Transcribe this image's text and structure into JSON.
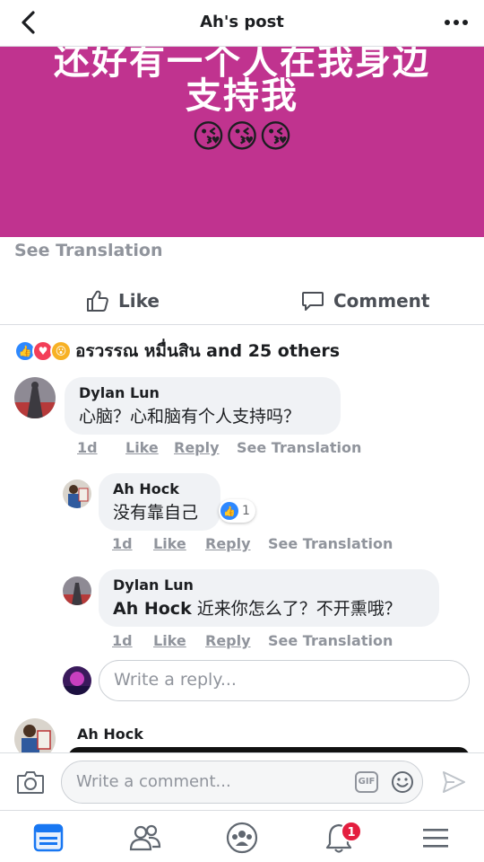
{
  "header": {
    "title": "Ah's post",
    "back_icon": "chevron-left-icon",
    "more_icon": "more-dots-icon"
  },
  "post": {
    "background_color": "#c0338f",
    "text_line1": "还好有一个人在我身边",
    "text_line2": "支持我",
    "emojis": "😘😘😘",
    "see_translation": "See Translation"
  },
  "actions": {
    "like_label": "Like",
    "comment_label": "Comment"
  },
  "reactions": {
    "icons": [
      "like",
      "love",
      "wow"
    ],
    "summary": "อรวรรณ หมื่นสิน and 25 others"
  },
  "comments": [
    {
      "author": "Dylan Lun",
      "body": "心脑？心和脑有个人支持吗？",
      "time": "1d",
      "like": "Like",
      "reply": "Reply",
      "see_translation": "See Translation"
    }
  ],
  "replies": [
    {
      "author": "Ah Hock",
      "body": "没有靠自己",
      "time": "1d",
      "like": "Like",
      "reply": "Reply",
      "see_translation": "See Translation",
      "like_count": "1"
    },
    {
      "author": "Dylan Lun",
      "mention": "Ah Hock",
      "body": "近来你怎么了？不开熏哦？",
      "time": "1d",
      "like": "Like",
      "reply": "Reply",
      "see_translation": "See Translation"
    }
  ],
  "reply_input": {
    "placeholder": "Write a reply..."
  },
  "next_comment": {
    "author": "Ah Hock"
  },
  "composer": {
    "placeholder": "Write a comment...",
    "gif_label": "GIF"
  },
  "bottom_nav": {
    "notification_badge": "1",
    "accent_color": "#1877f2"
  }
}
